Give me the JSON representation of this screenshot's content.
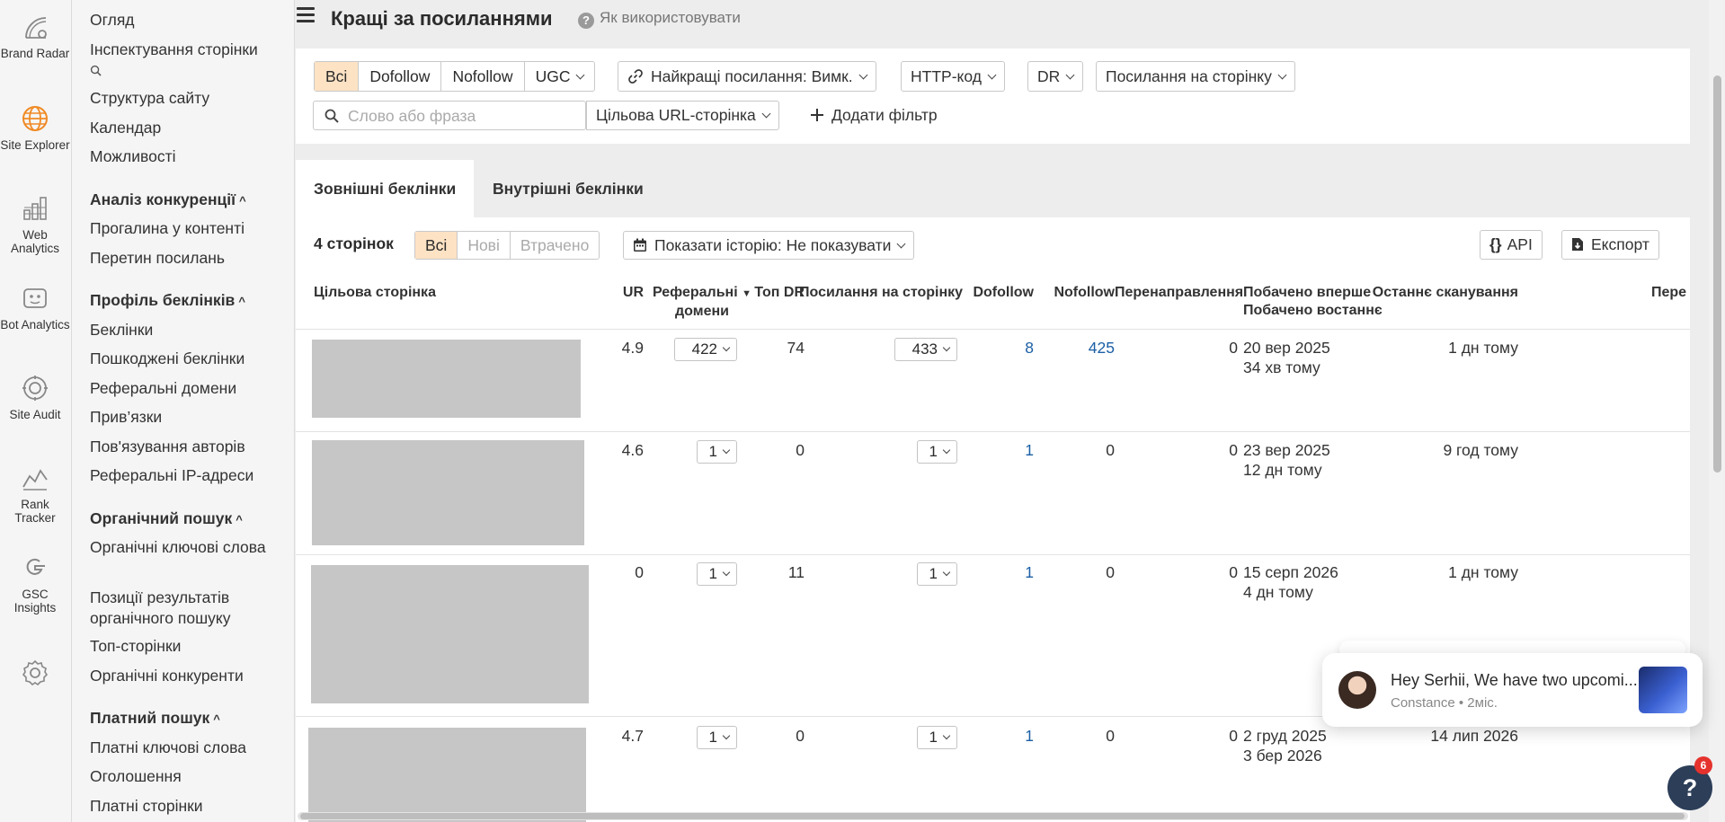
{
  "rail": {
    "items": [
      {
        "label": "Brand Radar",
        "icon": "brand-radar-icon"
      },
      {
        "label": "Site Explorer",
        "icon": "globe-icon"
      },
      {
        "label": "Web Analytics",
        "icon": "bar-chart-icon"
      },
      {
        "label": "Bot Analytics",
        "icon": "bot-icon"
      },
      {
        "label": "Site Audit",
        "icon": "audit-gear-icon"
      },
      {
        "label": "Rank Tracker",
        "icon": "rank-chart-icon"
      },
      {
        "label": "GSC Insights",
        "icon": "google-g-icon"
      }
    ],
    "accent": "#f08a24"
  },
  "sidebar": {
    "top_links": [
      "Огляд",
      "Інспектування сторінки",
      "Структура сайту",
      "Календар",
      "Можливості"
    ],
    "section_competitors": {
      "title": "Аналіз конкуренції",
      "items": [
        "Прогалина у контенті",
        "Перетин посилань"
      ]
    },
    "section_backlinks": {
      "title": "Профіль беклінків",
      "items": [
        "Беклінки",
        "Пошкоджені беклінки",
        "Реферальні домени",
        "Прив’язки",
        "Пов'язування авторів",
        "Реферальні IP-адреси"
      ]
    },
    "section_organic": {
      "title": "Органічний пошук",
      "items": [
        "Органічні ключові слова",
        "Позиції результатів органічного пошуку",
        "Топ-сторінки",
        "Органічні конкуренти"
      ]
    },
    "section_paid": {
      "title": "Платний пошук",
      "items": [
        "Платні ключові слова",
        "Оголошення",
        "Платні сторінки"
      ]
    }
  },
  "header": {
    "title": "Кращі за посиланнями",
    "help": "Як використовувати"
  },
  "filters": {
    "link_types": [
      "Всі",
      "Dofollow",
      "Nofollow",
      "UGC"
    ],
    "best_links": "Найкращі посилання: Вимк.",
    "http_code": "HTTP-код",
    "dr": "DR",
    "links_per_page": "Посилання на сторінку",
    "search_placeholder": "Слово або фраза",
    "target_url": "Цільова URL-сторінка",
    "add_filter": "Додати фільтр"
  },
  "tabs": [
    "Зовнішні беклінки",
    "Внутрішні беклінки"
  ],
  "toolbar": {
    "count": "4 сторінок",
    "status_filter": [
      "Всі",
      "Нові",
      "Втрачено"
    ],
    "history": "Показати історію: Не показувати",
    "api": "API",
    "export": "Експорт"
  },
  "table": {
    "headers": {
      "target": "Цільова сторінка",
      "ur": "UR",
      "ref_domains_1": "Реферальні",
      "ref_domains_2": "домени",
      "top_dr": "Топ DR",
      "links_per_page": "Посилання на сторінку",
      "dofollow": "Dofollow",
      "nofollow": "Nofollow",
      "redirects": "Перенаправлення",
      "first_seen": "Побачено вперше",
      "last_seen": "Побачено востаннє",
      "last_crawl": "Останнє сканування",
      "next": "Пере"
    },
    "rows": [
      {
        "ur": "4.9",
        "ref_domains": "422",
        "top_dr": "74",
        "links": "433",
        "dofollow": "8",
        "nofollow": "425",
        "redirects": "0",
        "first_seen": "20 вер 2025",
        "last_seen": "34 хв тому",
        "last_crawl": "1 дн тому"
      },
      {
        "ur": "4.6",
        "ref_domains": "1",
        "top_dr": "0",
        "links": "1",
        "dofollow": "1",
        "nofollow": "0",
        "redirects": "0",
        "first_seen": "23 вер 2025",
        "last_seen": "12 дн тому",
        "last_crawl": "9 год тому"
      },
      {
        "ur": "0",
        "ref_domains": "1",
        "top_dr": "11",
        "links": "1",
        "dofollow": "1",
        "nofollow": "0",
        "redirects": "0",
        "first_seen": "15 серп 2026",
        "last_seen": "4 дн тому",
        "last_crawl": "1 дн тому"
      },
      {
        "ur": "4.7",
        "ref_domains": "1",
        "top_dr": "0",
        "links": "1",
        "dofollow": "1",
        "nofollow": "0",
        "redirects": "0",
        "first_seen": "2 груд 2025",
        "last_seen": "3 бер 2026",
        "last_crawl": "14 лип 2026"
      }
    ]
  },
  "chat": {
    "message": "Hey Serhii, We have two upcomi...",
    "meta": "Constance • 2міс."
  },
  "help_fab": {
    "label": "?",
    "badge": "6"
  }
}
